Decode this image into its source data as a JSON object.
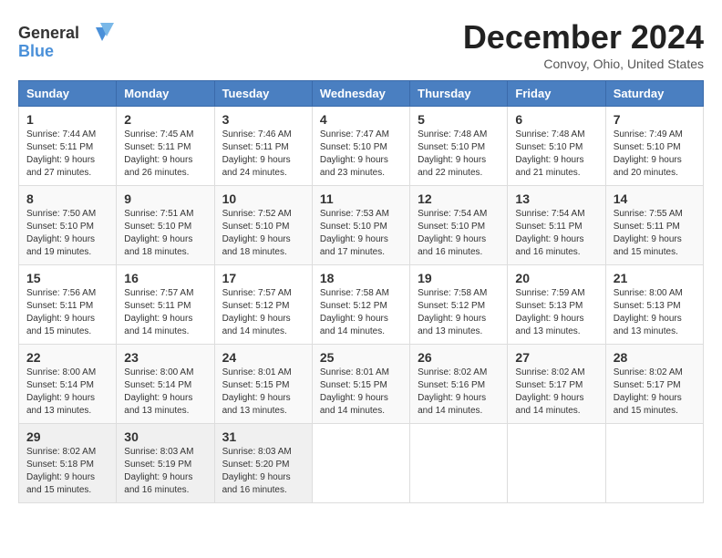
{
  "header": {
    "logo_general": "General",
    "logo_blue": "Blue",
    "month_title": "December 2024",
    "location": "Convoy, Ohio, United States"
  },
  "weekdays": [
    "Sunday",
    "Monday",
    "Tuesday",
    "Wednesday",
    "Thursday",
    "Friday",
    "Saturday"
  ],
  "weeks": [
    [
      {
        "day": "1",
        "sunrise": "7:44 AM",
        "sunset": "5:11 PM",
        "daylight": "9 hours and 27 minutes."
      },
      {
        "day": "2",
        "sunrise": "7:45 AM",
        "sunset": "5:11 PM",
        "daylight": "9 hours and 26 minutes."
      },
      {
        "day": "3",
        "sunrise": "7:46 AM",
        "sunset": "5:11 PM",
        "daylight": "9 hours and 24 minutes."
      },
      {
        "day": "4",
        "sunrise": "7:47 AM",
        "sunset": "5:10 PM",
        "daylight": "9 hours and 23 minutes."
      },
      {
        "day": "5",
        "sunrise": "7:48 AM",
        "sunset": "5:10 PM",
        "daylight": "9 hours and 22 minutes."
      },
      {
        "day": "6",
        "sunrise": "7:48 AM",
        "sunset": "5:10 PM",
        "daylight": "9 hours and 21 minutes."
      },
      {
        "day": "7",
        "sunrise": "7:49 AM",
        "sunset": "5:10 PM",
        "daylight": "9 hours and 20 minutes."
      }
    ],
    [
      {
        "day": "8",
        "sunrise": "7:50 AM",
        "sunset": "5:10 PM",
        "daylight": "9 hours and 19 minutes."
      },
      {
        "day": "9",
        "sunrise": "7:51 AM",
        "sunset": "5:10 PM",
        "daylight": "9 hours and 18 minutes."
      },
      {
        "day": "10",
        "sunrise": "7:52 AM",
        "sunset": "5:10 PM",
        "daylight": "9 hours and 18 minutes."
      },
      {
        "day": "11",
        "sunrise": "7:53 AM",
        "sunset": "5:10 PM",
        "daylight": "9 hours and 17 minutes."
      },
      {
        "day": "12",
        "sunrise": "7:54 AM",
        "sunset": "5:10 PM",
        "daylight": "9 hours and 16 minutes."
      },
      {
        "day": "13",
        "sunrise": "7:54 AM",
        "sunset": "5:11 PM",
        "daylight": "9 hours and 16 minutes."
      },
      {
        "day": "14",
        "sunrise": "7:55 AM",
        "sunset": "5:11 PM",
        "daylight": "9 hours and 15 minutes."
      }
    ],
    [
      {
        "day": "15",
        "sunrise": "7:56 AM",
        "sunset": "5:11 PM",
        "daylight": "9 hours and 15 minutes."
      },
      {
        "day": "16",
        "sunrise": "7:57 AM",
        "sunset": "5:11 PM",
        "daylight": "9 hours and 14 minutes."
      },
      {
        "day": "17",
        "sunrise": "7:57 AM",
        "sunset": "5:12 PM",
        "daylight": "9 hours and 14 minutes."
      },
      {
        "day": "18",
        "sunrise": "7:58 AM",
        "sunset": "5:12 PM",
        "daylight": "9 hours and 14 minutes."
      },
      {
        "day": "19",
        "sunrise": "7:58 AM",
        "sunset": "5:12 PM",
        "daylight": "9 hours and 13 minutes."
      },
      {
        "day": "20",
        "sunrise": "7:59 AM",
        "sunset": "5:13 PM",
        "daylight": "9 hours and 13 minutes."
      },
      {
        "day": "21",
        "sunrise": "8:00 AM",
        "sunset": "5:13 PM",
        "daylight": "9 hours and 13 minutes."
      }
    ],
    [
      {
        "day": "22",
        "sunrise": "8:00 AM",
        "sunset": "5:14 PM",
        "daylight": "9 hours and 13 minutes."
      },
      {
        "day": "23",
        "sunrise": "8:00 AM",
        "sunset": "5:14 PM",
        "daylight": "9 hours and 13 minutes."
      },
      {
        "day": "24",
        "sunrise": "8:01 AM",
        "sunset": "5:15 PM",
        "daylight": "9 hours and 13 minutes."
      },
      {
        "day": "25",
        "sunrise": "8:01 AM",
        "sunset": "5:15 PM",
        "daylight": "9 hours and 14 minutes."
      },
      {
        "day": "26",
        "sunrise": "8:02 AM",
        "sunset": "5:16 PM",
        "daylight": "9 hours and 14 minutes."
      },
      {
        "day": "27",
        "sunrise": "8:02 AM",
        "sunset": "5:17 PM",
        "daylight": "9 hours and 14 minutes."
      },
      {
        "day": "28",
        "sunrise": "8:02 AM",
        "sunset": "5:17 PM",
        "daylight": "9 hours and 15 minutes."
      }
    ],
    [
      {
        "day": "29",
        "sunrise": "8:02 AM",
        "sunset": "5:18 PM",
        "daylight": "9 hours and 15 minutes."
      },
      {
        "day": "30",
        "sunrise": "8:03 AM",
        "sunset": "5:19 PM",
        "daylight": "9 hours and 16 minutes."
      },
      {
        "day": "31",
        "sunrise": "8:03 AM",
        "sunset": "5:20 PM",
        "daylight": "9 hours and 16 minutes."
      },
      null,
      null,
      null,
      null
    ]
  ]
}
